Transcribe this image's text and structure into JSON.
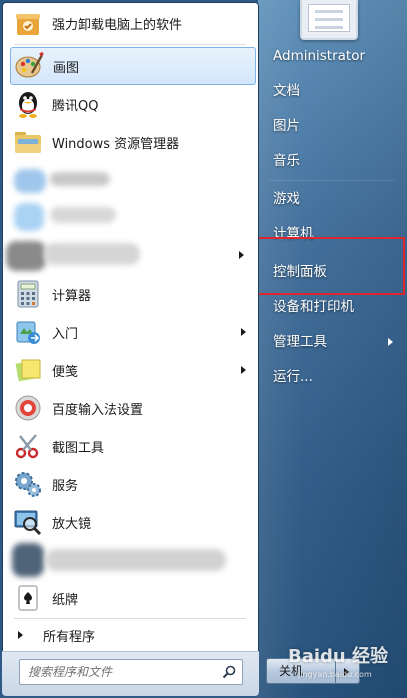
{
  "programs": [
    {
      "name": "uninstall",
      "label": "强力卸载电脑上的软件",
      "icon": "uninstall-box-icon"
    },
    {
      "name": "paint",
      "label": "画图",
      "icon": "paint-palette-icon"
    },
    {
      "name": "qq",
      "label": "腾讯QQ",
      "icon": "qq-penguin-icon"
    },
    {
      "name": "explorer",
      "label": "Windows 资源管理器",
      "icon": "folder-icon"
    },
    {
      "name": "blurred-1",
      "label": "",
      "icon": "blurred-icon"
    },
    {
      "name": "blurred-2",
      "label": "",
      "icon": "blurred-icon"
    },
    {
      "name": "blurred-3",
      "label": "",
      "icon": "blurred-icon"
    },
    {
      "name": "calculator",
      "label": "计算器",
      "icon": "calculator-icon"
    },
    {
      "name": "getting-started",
      "label": "入门",
      "icon": "getting-started-icon"
    },
    {
      "name": "sticky-notes",
      "label": "便笺",
      "icon": "sticky-notes-icon"
    },
    {
      "name": "baidu-ime-settings",
      "label": "百度输入法设置",
      "icon": "settings-ring-icon"
    },
    {
      "name": "snipping-tool",
      "label": "截图工具",
      "icon": "scissors-icon"
    },
    {
      "name": "services",
      "label": "服务",
      "icon": "gears-icon"
    },
    {
      "name": "magnifier",
      "label": "放大镜",
      "icon": "magnifier-icon"
    },
    {
      "name": "blurred-4",
      "label": "",
      "icon": "blurred-icon"
    },
    {
      "name": "solitaire",
      "label": "纸牌",
      "icon": "playing-card-icon"
    }
  ],
  "all_programs_label": "所有程序",
  "search": {
    "placeholder": "搜索程序和文件"
  },
  "right_menu": {
    "user": "Administrator",
    "documents": "文档",
    "pictures": "图片",
    "music": "音乐",
    "games": "游戏",
    "computer": "计算机",
    "control_panel": "控制面板",
    "devices_printers": "设备和打印机",
    "admin_tools": "管理工具",
    "run": "运行..."
  },
  "shutdown_label": "关机",
  "watermark": {
    "text": "Baidu 经验",
    "url": "jingyan.baidu.com"
  },
  "colors": {
    "highlight_border": "#e0262d",
    "selected_bg": "#d4e6fb"
  }
}
